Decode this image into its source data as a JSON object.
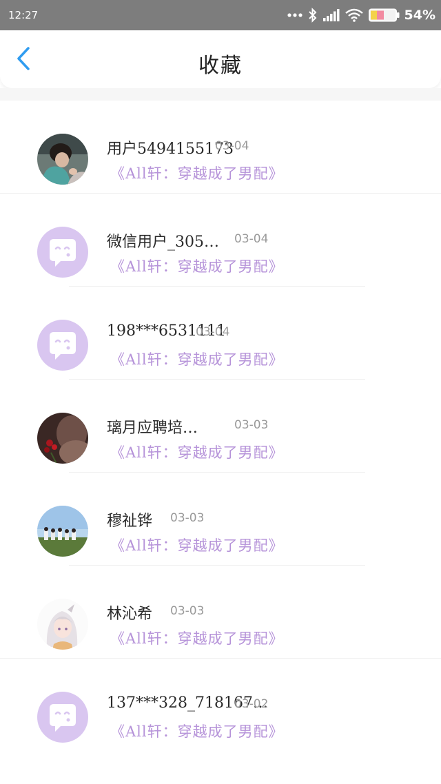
{
  "status_bar": {
    "time": "12:27",
    "battery": "54%",
    "icons": [
      "more-dots-icon",
      "bluetooth-icon",
      "signal-icon",
      "wifi-icon",
      "battery-icon"
    ]
  },
  "header": {
    "title": "收藏",
    "back_icon": "back-arrow-icon"
  },
  "colors": {
    "accent_blue": "#2f9cf0",
    "book_purple": "#b693d9",
    "default_avatar": "#d9c6f0",
    "status_bar": "#7d7d7d"
  },
  "items": [
    {
      "name": "用户5494155173",
      "date": "03-04",
      "book": "《All轩：穿越成了男配》",
      "avatar": "photo-avatar-1"
    },
    {
      "name": "微信用户_305…",
      "date": "03-04",
      "book": "《All轩：穿越成了男配》",
      "avatar": "default-avatar"
    },
    {
      "name": "198***6531111",
      "date": "03-04",
      "book": "《All轩：穿越成了男配》",
      "avatar": "default-avatar"
    },
    {
      "name": "璃月应聘培…",
      "date": "03-03",
      "book": "《All轩：穿越成了男配》",
      "avatar": "photo-avatar-rose"
    },
    {
      "name": "穆祉铧",
      "date": "03-03",
      "book": "《All轩：穿越成了男配》",
      "avatar": "photo-avatar-group"
    },
    {
      "name": "林沁希",
      "date": "03-03",
      "book": "《All轩：穿越成了男配》",
      "avatar": "anime-avatar"
    },
    {
      "name": "137***328_718167…",
      "date": "03-02",
      "book": "《All轩：穿越成了男配》",
      "avatar": "default-avatar"
    }
  ]
}
